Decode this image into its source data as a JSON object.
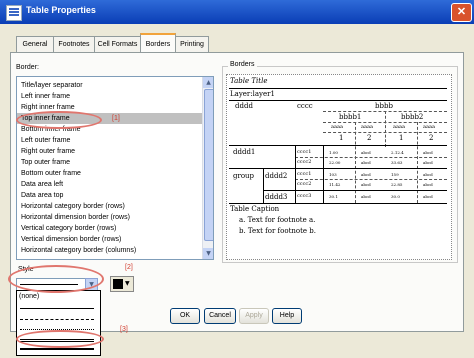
{
  "window": {
    "title": "Table Properties",
    "close_symbol": "✕"
  },
  "tabs": [
    {
      "label": "General"
    },
    {
      "label": "Footnotes"
    },
    {
      "label": "Cell Formats"
    },
    {
      "label": "Borders"
    },
    {
      "label": "Printing"
    }
  ],
  "border_label": "Border:",
  "border_list": [
    "Title/layer separator",
    "Left inner frame",
    "Right inner frame",
    "Top inner frame",
    "Bottom inner frame",
    "Left outer frame",
    "Right outer frame",
    "Top outer frame",
    "Bottom outer frame",
    "Data area left",
    "Data area top",
    "Horizontal category border (rows)",
    "Horizontal dimension border (rows)",
    "Vertical category border (rows)",
    "Vertical dimension border (rows)",
    "Horizontal category border (columns)"
  ],
  "selected_border": "Top inner frame",
  "borders_group_label": "Borders",
  "preview": {
    "table_title": "Table Title",
    "layer": "Layer:layer1",
    "dddd": "dddd",
    "cccc": "cccc",
    "bbbb": "bbbb",
    "bbbb1": "bbbb1",
    "bbbb2": "bbbb2",
    "aaaa_labels": [
      "aaaa",
      "aaaa",
      "aaaa",
      "aaaa"
    ],
    "num1": "1",
    "num2": "2",
    "dddd1": "dddd1",
    "group": "group",
    "dddd2": "dddd2",
    "dddd3": "dddd3",
    "cccc1": "cccc1",
    "cccc2": "cccc2",
    "rows": [
      [
        "cccc1",
        "1.00",
        "abcd",
        "2.12.4",
        "abcd"
      ],
      [
        "cccc2",
        "22.00",
        "abcd",
        "33.63",
        "abcd"
      ],
      [
        "cccc1",
        "103",
        "abcd",
        "159",
        "abcd"
      ],
      [
        "cccc2",
        "11.42",
        "abcd",
        "22.85",
        "abcd"
      ],
      [
        "cccc3",
        "30.1",
        "abcd",
        "30.0",
        "abcd"
      ]
    ],
    "caption": "Table Caption",
    "footnote_a": "a. Text for footnote a.",
    "footnote_b": "b. Text for footnote b."
  },
  "style_label": "Style",
  "style_options": [
    "(none)"
  ],
  "buttons": {
    "ok": "OK",
    "cancel": "Cancel",
    "apply": "Apply",
    "help": "Help"
  },
  "annotations": {
    "a1": "[1]",
    "a2": "[2]",
    "a3": "[3]"
  },
  "accent_colors": {
    "title_bar": "#0a3db5",
    "annotation": "#d03c2e",
    "tab_highlight": "#f1a33b"
  }
}
